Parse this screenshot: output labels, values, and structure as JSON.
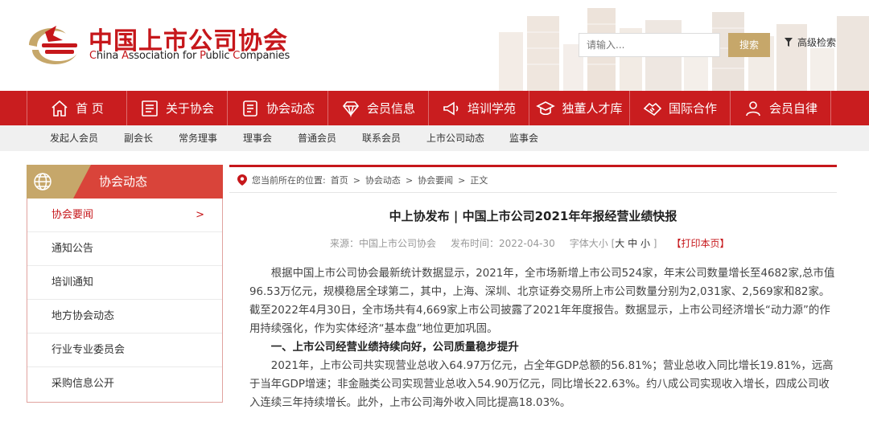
{
  "header": {
    "brand_cn": "中国上市公司协会",
    "brand_en_parts": [
      "C",
      "hina ",
      "A",
      "ssociation for ",
      "P",
      "ublic ",
      "C",
      "ompanies"
    ],
    "search_placeholder": "请输入...",
    "search_button": "搜索",
    "advanced_search": "高级检索"
  },
  "colors": {
    "brand_red": "#c91d1f",
    "gold": "#c6a76a",
    "sidebar_head": "#d9443a"
  },
  "mainnav": [
    {
      "label": "首 页",
      "icon": "home-icon"
    },
    {
      "label": "关于协会",
      "icon": "document-list-icon"
    },
    {
      "label": "协会动态",
      "icon": "news-icon"
    },
    {
      "label": "会员信息",
      "icon": "diamond-icon"
    },
    {
      "label": "培训学苑",
      "icon": "megaphone-icon"
    },
    {
      "label": "独董人才库",
      "icon": "graduation-cap-icon"
    },
    {
      "label": "国际合作",
      "icon": "handshake-icon"
    },
    {
      "label": "会员自律",
      "icon": "users-icon"
    }
  ],
  "subnav": [
    "发起人会员",
    "副会长",
    "常务理事",
    "理事会",
    "普通会员",
    "联系会员",
    "上市公司动态",
    "监事会"
  ],
  "sidebar": {
    "title": "协会动态",
    "items": [
      "协会要闻",
      "通知公告",
      "培训通知",
      "地方协会动态",
      "行业专业委员会",
      "采购信息公开"
    ],
    "active_arrow": ">"
  },
  "breadcrumb": {
    "prefix": "您当前所在的位置:",
    "items": [
      "首页",
      "协会动态",
      "协会要闻",
      "正文"
    ],
    "separator": ">"
  },
  "article": {
    "title": "中上协发布 | 中国上市公司2021年年报经营业绩快报",
    "source": "来源：中国上市公司协会",
    "date": "发布时间：2022-04-30",
    "font_size_label": "字体大小 [",
    "font_sizes": [
      "大",
      "中",
      "小"
    ],
    "font_size_close": "]",
    "print": "【打印本页】",
    "para1": "根据中国上市公司协会最新统计数据显示，2021年，全市场新增上市公司524家，年末公司数量增长至4682家,总市值96.53万亿元，规模稳居全球第二，其中，上海、深圳、北京证券交易所上市公司数量分别为2,031家、2,569家和82家。截至2022年4月30日，全市场共有4,669家上市公司披露了2021年年度报告。数据显示，上市公司经济增长“动力源”的作用持续强化，作为实体经济“基本盘”地位更加巩固。",
    "heading1": "一、上市公司经营业绩持续向好，公司质量稳步提升",
    "para2": "2021年，上市公司共实现营业总收入64.97万亿元，占全年GDP总额的56.81%；营业总收入同比增长19.81%，远高于当年GDP增速；非金融类公司实现营业总收入54.90万亿元，同比增长22.63%。约八成公司实现收入增长，四成公司收入连续三年持续增长。此外，上市公司海外收入同比提高18.03%。"
  }
}
